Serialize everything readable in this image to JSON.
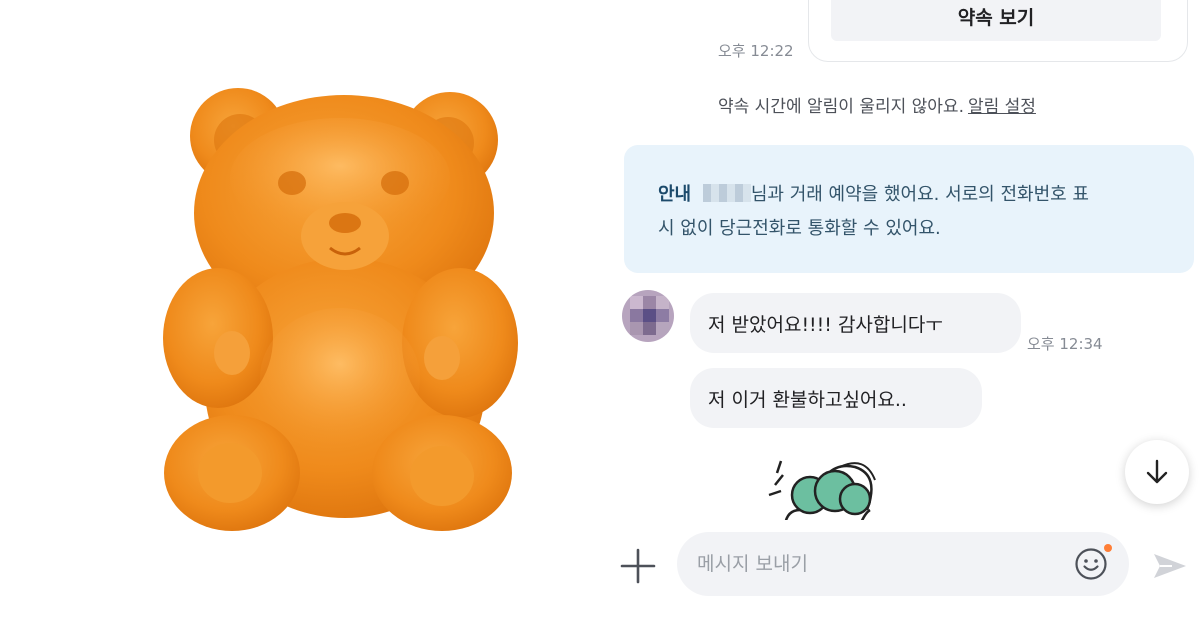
{
  "chat": {
    "appointment_button_label": "약속 보기",
    "time_1": "오후 12:22",
    "notice_text": "약속 시간에 알림이 울리지 않아요.",
    "notice_link": "알림 설정",
    "info_label": "안내",
    "info_text_1": "님과 거래 예약을 했어요. 서로의 전화번호 표",
    "info_text_2": "시 없이 당근전화로 통화할 수 있어요.",
    "messages": [
      {
        "text": "저 받았어요!!!! 감사합니다ㅜ"
      },
      {
        "text": "저 이거 환불하고싶어요.."
      }
    ],
    "time_2": "오후 12:34"
  },
  "composer": {
    "placeholder": "메시지 보내기"
  },
  "icons": {
    "plus": "plus-icon",
    "emoji": "smiley-icon",
    "send": "send-icon",
    "scroll_down": "arrow-down-icon"
  },
  "colors": {
    "bear": "#f08a1c",
    "info_bg": "#e8f3fb",
    "bubble_bg": "#f2f3f6",
    "accent_dot": "#ff7e36"
  }
}
